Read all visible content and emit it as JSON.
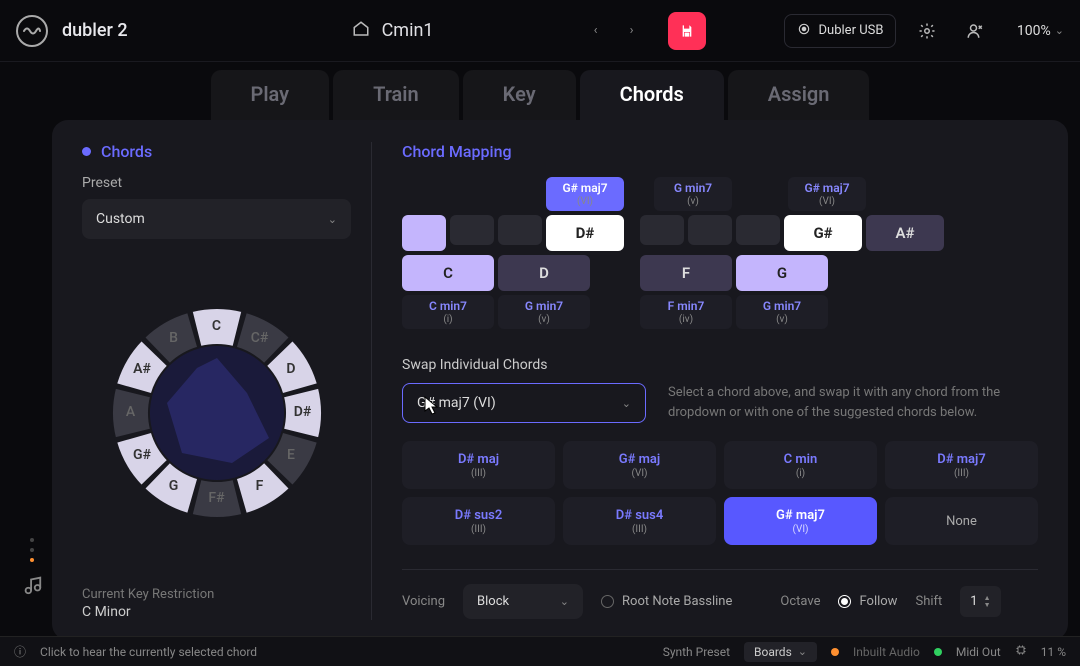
{
  "app_title": "dubler 2",
  "song_name": "Cmin1",
  "device_name": "Dubler USB",
  "zoom_level": "100%",
  "tabs": [
    "Play",
    "Train",
    "Key",
    "Chords",
    "Assign"
  ],
  "active_tab": "Chords",
  "sidebar": {
    "section_title": "Chords",
    "preset_label": "Preset",
    "preset_value": "Custom",
    "key_restriction_label": "Current Key Restriction",
    "key_restriction_value": "C Minor"
  },
  "wheel_notes": {
    "C": {
      "angle": -90,
      "active": true
    },
    "C#": {
      "angle": -60,
      "active": false
    },
    "D": {
      "angle": -30,
      "active": true
    },
    "D#": {
      "angle": 0,
      "active": true
    },
    "E": {
      "angle": 30,
      "active": false
    },
    "F": {
      "angle": 60,
      "active": true
    },
    "F#": {
      "angle": 90,
      "active": false
    },
    "G": {
      "angle": 120,
      "active": true
    },
    "G#": {
      "angle": 150,
      "active": true
    },
    "A": {
      "angle": 180,
      "active": false
    },
    "A#": {
      "angle": 210,
      "active": true
    },
    "B": {
      "angle": 240,
      "active": false
    }
  },
  "mapping": {
    "title": "Chord Mapping",
    "group1": {
      "top": [
        {
          "label": "G# maj7",
          "num": "(VI)",
          "sel": true,
          "w": 78,
          "offset": 144
        }
      ],
      "mid": [
        {
          "label": "",
          "w": 44,
          "cls": "note"
        },
        {
          "label": "",
          "w": 44,
          "cls": "empty"
        },
        {
          "label": "",
          "w": 44,
          "cls": "empty"
        },
        {
          "label": "D#",
          "w": 78,
          "cls": "note",
          "strong": true
        }
      ],
      "mid2": [
        {
          "label": "C",
          "w": 92,
          "cls": "note"
        },
        {
          "label": "D",
          "w": 92,
          "cls": "note dark"
        }
      ],
      "bot": [
        {
          "label": "C min7",
          "num": "(i)",
          "w": 92
        },
        {
          "label": "G min7",
          "num": "(v)",
          "w": 92
        }
      ]
    },
    "group2": {
      "top": [
        {
          "label": "G# maj7",
          "num": "(VI)",
          "w": 78,
          "offset": 148
        },
        {
          "label": "G min7",
          "num": "(v)",
          "w": 78,
          "offset": 14
        }
      ],
      "mid": [
        {
          "label": "",
          "w": 44,
          "cls": "empty"
        },
        {
          "label": "",
          "w": 44,
          "cls": "empty"
        },
        {
          "label": "",
          "w": 44,
          "cls": "empty"
        },
        {
          "label": "G#",
          "w": 78,
          "cls": "note",
          "strong": true
        },
        {
          "label": "A#",
          "w": 78,
          "cls": "note dark"
        }
      ],
      "mid2": [
        {
          "label": "F",
          "w": 92,
          "cls": "note dark"
        },
        {
          "label": "G",
          "w": 92,
          "cls": "note"
        }
      ],
      "bot": [
        {
          "label": "F min7",
          "num": "(iv)",
          "w": 92
        },
        {
          "label": "G min7",
          "num": "(v)",
          "w": 92
        }
      ]
    }
  },
  "swap": {
    "label": "Swap Individual Chords",
    "value": "G# maj7 (VI)",
    "help": "Select a chord above, and swap it with any chord from the dropdown or with one of the suggested chords below.",
    "suggestions": [
      {
        "name": "D# maj",
        "num": "(III)"
      },
      {
        "name": "G# maj",
        "num": "(VI)"
      },
      {
        "name": "C min",
        "num": "(i)"
      },
      {
        "name": "D# maj7",
        "num": "(III)"
      },
      {
        "name": "D# sus2",
        "num": "(III)"
      },
      {
        "name": "D# sus4",
        "num": "(III)"
      },
      {
        "name": "G# maj7",
        "num": "(VI)",
        "active": true
      },
      {
        "name": "None",
        "num": "",
        "none": true
      }
    ]
  },
  "voicing": {
    "label": "Voicing",
    "value": "Block",
    "root_label": "Root Note Bassline",
    "octave_label": "Octave",
    "follow_label": "Follow",
    "shift_label": "Shift",
    "shift_value": "1"
  },
  "footer": {
    "hint": "Click to hear the currently selected chord",
    "synth_preset_label": "Synth Preset",
    "synth_preset_value": "Boards",
    "inbuilt_audio": "Inbuilt Audio",
    "midi_out": "Midi Out",
    "cpu": "11 %"
  }
}
